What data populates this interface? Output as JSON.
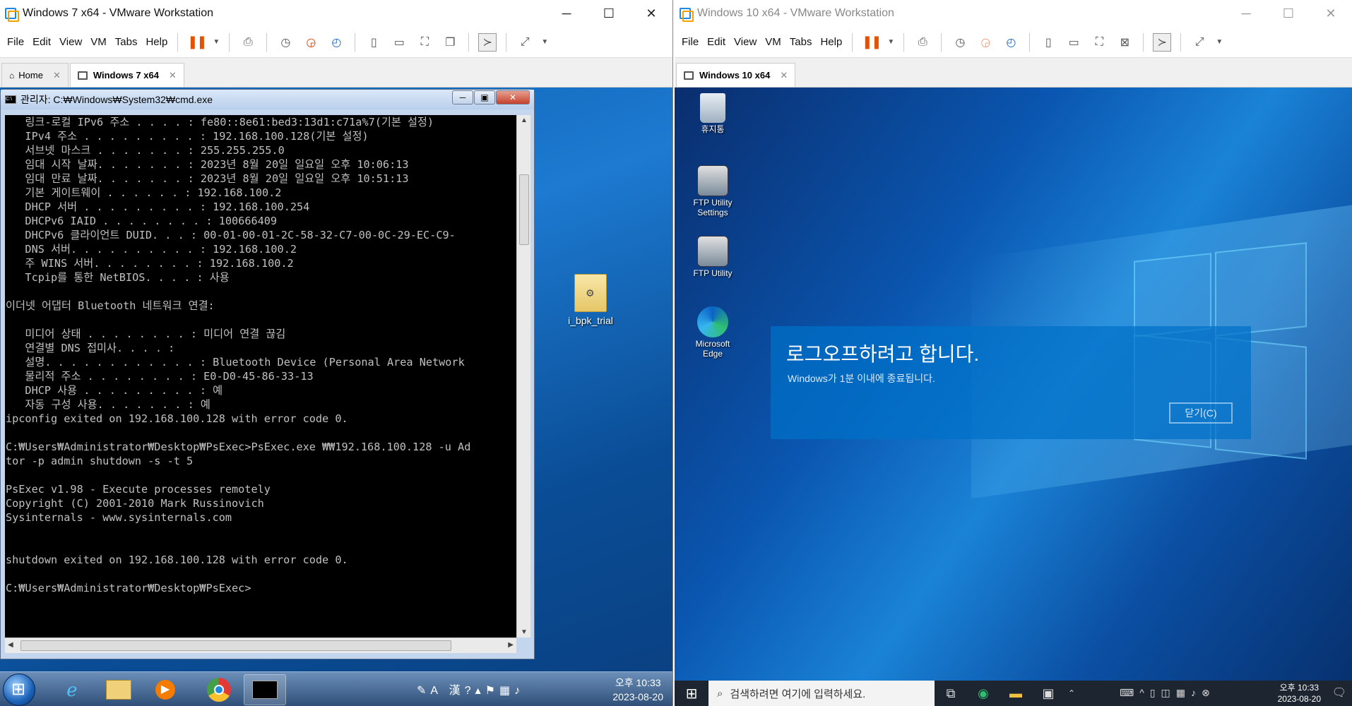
{
  "left_vm": {
    "title": "Windows 7 x64 - VMware Workstation",
    "menu": [
      "File",
      "Edit",
      "View",
      "VM",
      "Tabs",
      "Help"
    ],
    "tabs": [
      {
        "label": "Home"
      },
      {
        "label": "Windows 7 x64"
      }
    ],
    "cmd": {
      "title": "관리자: C:₩Windows₩System32₩cmd.exe",
      "lines": [
        "   링크-로컬 IPv6 주소 . . . . : fe80::8e61:bed3:13d1:c71a%7(기본 설정)",
        "   IPv4 주소 . . . . . . . . . : 192.168.100.128(기본 설정)",
        "   서브넷 마스크 . . . . . . . : 255.255.255.0",
        "   임대 시작 날짜. . . . . . . : 2023년 8월 20일 일요일 오후 10:06:13",
        "   임대 만료 날짜. . . . . . . : 2023년 8월 20일 일요일 오후 10:51:13",
        "   기본 게이트웨이 . . . . . . : 192.168.100.2",
        "   DHCP 서버 . . . . . . . . . : 192.168.100.254",
        "   DHCPv6 IAID . . . . . . . . : 100666409",
        "   DHCPv6 클라이언트 DUID. . . : 00-01-00-01-2C-58-32-C7-00-0C-29-EC-C9-",
        "   DNS 서버. . . . . . . . . . : 192.168.100.2",
        "   주 WINS 서버. . . . . . . . : 192.168.100.2",
        "   Tcpip를 통한 NetBIOS. . . . : 사용",
        "",
        "이더넷 어댑터 Bluetooth 네트워크 연결:",
        "",
        "   미디어 상태 . . . . . . . . : 미디어 연결 끊김",
        "   연결별 DNS 접미사. . . . :",
        "   설명. . . . . . . . . . . . : Bluetooth Device (Personal Area Network",
        "   물리적 주소 . . . . . . . . : E0-D0-45-86-33-13",
        "   DHCP 사용 . . . . . . . . . : 예",
        "   자동 구성 사용. . . . . . . : 예",
        "ipconfig exited on 192.168.100.128 with error code 0.",
        "",
        "C:₩Users₩Administrator₩Desktop₩PsExec>PsExec.exe ₩₩192.168.100.128 -u Ad",
        "tor -p admin shutdown -s -t 5",
        "",
        "PsExec v1.98 - Execute processes remotely",
        "Copyright (C) 2001-2010 Mark Russinovich",
        "Sysinternals - www.sysinternals.com",
        "",
        "",
        "shutdown exited on 192.168.100.128 with error code 0.",
        "",
        "C:₩Users₩Administrator₩Desktop₩PsExec>"
      ]
    },
    "desktop_icons": [
      {
        "label": "i_bpk_trial"
      }
    ],
    "taskbar": {
      "time": "오후 10:33",
      "date": "2023-08-20",
      "ime": "A 漢"
    }
  },
  "right_vm": {
    "title": "Windows 10 x64 - VMware Workstation",
    "menu": [
      "File",
      "Edit",
      "View",
      "VM",
      "Tabs",
      "Help"
    ],
    "tabs": [
      {
        "label": "Windows 10 x64"
      }
    ],
    "desktop_icons": [
      {
        "label": "휴지통"
      },
      {
        "label": "FTP Utility Settings"
      },
      {
        "label": "FTP Utility"
      },
      {
        "label": "Microsoft Edge"
      }
    ],
    "logoff": {
      "heading": "로그오프하려고 합니다.",
      "sub": "Windows가 1분 이내에 종료됩니다.",
      "button": "닫기(C)"
    },
    "taskbar": {
      "search_placeholder": "검색하려면 여기에 입력하세요.",
      "time": "오후 10:33",
      "date": "2023-08-20"
    }
  }
}
